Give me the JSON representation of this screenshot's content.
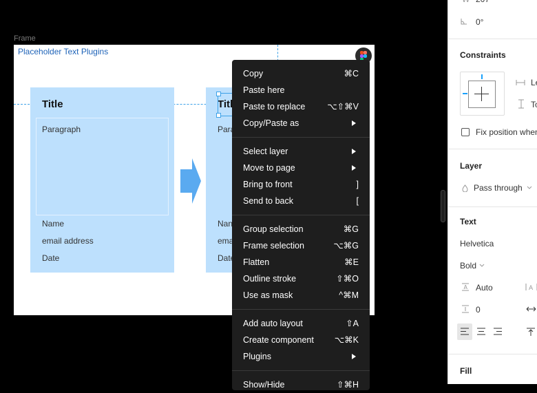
{
  "canvas": {
    "frame_label": "Frame",
    "frame_title": "Placeholder Text Plugins",
    "card1": {
      "title": "Title",
      "paragraph": "Paragraph",
      "name": "Name",
      "email": "email address",
      "date": "Date"
    },
    "card2": {
      "title": "Titl",
      "paragraph": "Para",
      "name": "Nan",
      "email": "ema",
      "date": "Date"
    }
  },
  "context_menu": {
    "items": [
      {
        "label": "Copy",
        "shortcut": "⌘C"
      },
      {
        "label": "Paste here",
        "shortcut": ""
      },
      {
        "label": "Paste to replace",
        "shortcut": "⌥⇧⌘V"
      },
      {
        "label": "Copy/Paste as",
        "shortcut": "",
        "submenu": true
      },
      {
        "label": "Select layer",
        "shortcut": "",
        "submenu": true
      },
      {
        "label": "Move to page",
        "shortcut": "",
        "submenu": true
      },
      {
        "label": "Bring to front",
        "shortcut": "]"
      },
      {
        "label": "Send to back",
        "shortcut": "["
      },
      {
        "label": "Group selection",
        "shortcut": "⌘G"
      },
      {
        "label": "Frame selection",
        "shortcut": "⌥⌘G"
      },
      {
        "label": "Flatten",
        "shortcut": "⌘E"
      },
      {
        "label": "Outline stroke",
        "shortcut": "⇧⌘O"
      },
      {
        "label": "Use as mask",
        "shortcut": "^⌘M"
      },
      {
        "label": "Add auto layout",
        "shortcut": "⇧A"
      },
      {
        "label": "Create component",
        "shortcut": "⌥⌘K"
      },
      {
        "label": "Plugins",
        "shortcut": "",
        "submenu": true
      },
      {
        "label": "Show/Hide",
        "shortcut": "⇧⌘H"
      }
    ]
  },
  "properties_panel": {
    "width_label": "W",
    "width_value": "207",
    "rotation_value": "0°",
    "constraints_heading": "Constraints",
    "constraint_h": "Le",
    "constraint_v": "To",
    "fix_position_label": "Fix position when",
    "layer_heading": "Layer",
    "blend_mode": "Pass through",
    "text_heading": "Text",
    "font_family": "Helvetica",
    "font_weight": "Bold",
    "line_height": "Auto",
    "paragraph_spacing": "0",
    "fill_heading": "Fill"
  },
  "colors": {
    "canvas_bg": "#000000",
    "menu_bg": "#1e1e1e",
    "card_fill": "#bde0fd",
    "selection": "#3aa0e8",
    "arrow_fill": "#5aaaf0"
  }
}
